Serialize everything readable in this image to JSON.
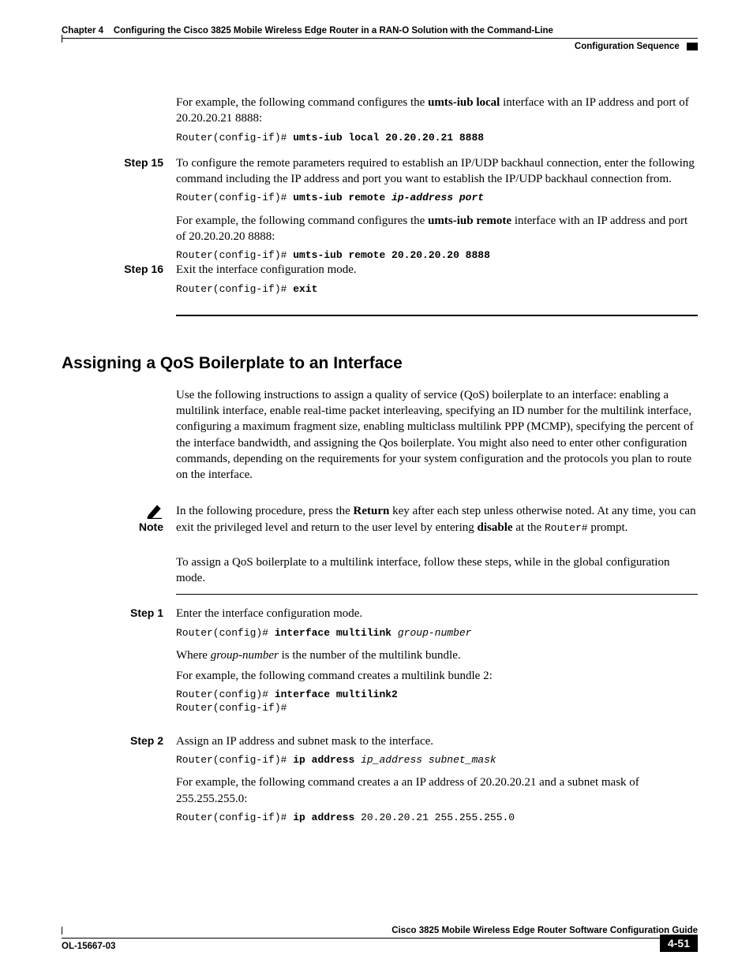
{
  "header": {
    "chapter_label": "Chapter 4",
    "chapter_title": "Configuring the Cisco 3825 Mobile Wireless Edge Router in a RAN-O Solution with the Command-Line",
    "section": "Configuration Sequence"
  },
  "top_content": {
    "intro_para_pre": "For example, the following command configures the ",
    "intro_para_bold": "umts-iub local",
    "intro_para_post": " interface with an IP address and port of 20.20.20.21 8888:",
    "code1_prompt": "Router(config-if)# ",
    "code1_cmd": "umts-iub local 20.20.20.21 8888"
  },
  "step15": {
    "label": "Step 15",
    "para1": "To configure the remote parameters required to establish an IP/UDP backhaul connection, enter the following command including the IP address and port you want to establish the IP/UDP backhaul connection from.",
    "code1_prompt": "Router(config-if)# ",
    "code1_cmd": "umts-iub remote ",
    "code1_args": "ip-address port",
    "para2_pre": "For example, the following command configures the ",
    "para2_bold": "umts-iub remote",
    "para2_post": " interface with an IP address and port of 20.20.20.20 8888:",
    "code2_prompt": "Router(config-if)# ",
    "code2_cmd": "umts-iub remote 20.20.20.20 8888"
  },
  "step16": {
    "label": "Step 16",
    "para1": "Exit the interface configuration mode.",
    "code1_prompt": "Router(config-if)# ",
    "code1_cmd": "exit"
  },
  "section": {
    "heading": "Assigning a QoS Boilerplate to an Interface",
    "intro": "Use the following instructions to assign a quality of service (QoS) boilerplate to an interface: enabling a multilink interface, enable real-time packet interleaving, specifying an ID number for the multilink interface, configuring a maximum fragment size, enabling multiclass multilink PPP (MCMP), specifying the percent of the interface bandwidth, and assigning the Qos boilerplate. You might also need to enter other configuration commands, depending on the requirements for your system configuration and the protocols you plan to route on the interface."
  },
  "note": {
    "label": "Note",
    "text_pre": "In the following procedure, press the ",
    "text_b1": "Return",
    "text_mid": " key after each step unless otherwise noted. At any time, you can exit the privileged level and return to the user level by entering ",
    "text_b2": "disable",
    "text_post1": " at the ",
    "text_mono": "Router#",
    "text_post2": " prompt."
  },
  "lead_para": "To assign a QoS boilerplate to a multilink interface, follow these steps, while in the global configuration mode.",
  "step1": {
    "label": "Step 1",
    "para1": "Enter the interface configuration mode.",
    "code1_prompt": "Router(config)# ",
    "code1_cmd": "interface multilink ",
    "code1_args": "group-number",
    "para2_pre": "Where ",
    "para2_i": "group-number",
    "para2_post": " is the number of the multilink bundle.",
    "para3": "For example, the following command creates a multilink bundle 2:",
    "code2_line1_prompt": "Router(config)# ",
    "code2_line1_cmd": "interface multilink2",
    "code2_line2": "Router(config-if)#"
  },
  "step2": {
    "label": "Step 2",
    "para1": "Assign an IP address and subnet mask to the interface.",
    "code1_prompt": "Router(config-if)# ",
    "code1_cmd": "ip address ",
    "code1_args": "ip_address subnet_mask",
    "para2": "For example, the following command creates a an IP address of 20.20.20.21 and a subnet mask of 255.255.255.0:",
    "code2_prompt": "Router(config-if)# ",
    "code2_cmd": "ip address ",
    "code2_args": "20.20.20.21 255.255.255.0"
  },
  "footer": {
    "book_title": "Cisco 3825 Mobile Wireless Edge Router Software Configuration Guide",
    "doc_id": "OL-15667-03",
    "page_number": "4-51"
  }
}
